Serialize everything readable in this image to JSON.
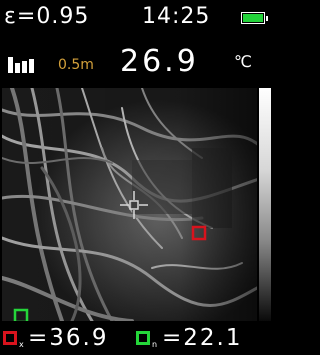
{
  "status_bar": {
    "emissivity": "ε=0.95",
    "time": "14:25",
    "battery_level": 1.0,
    "battery_color": "#23d23a"
  },
  "measurement": {
    "distance_ratio": "0.5m",
    "center_temp": "26.9",
    "unit": "℃"
  },
  "thermal_image": {
    "palette": "grayscale",
    "crosshair_icon": "crosshair-icon",
    "max_marker_color": "#d8131d",
    "min_marker_color": "#25d63a"
  },
  "readouts": {
    "max_subscript": "x",
    "max_value": "=36.9",
    "min_subscript": "n",
    "min_value": "=22.1"
  }
}
